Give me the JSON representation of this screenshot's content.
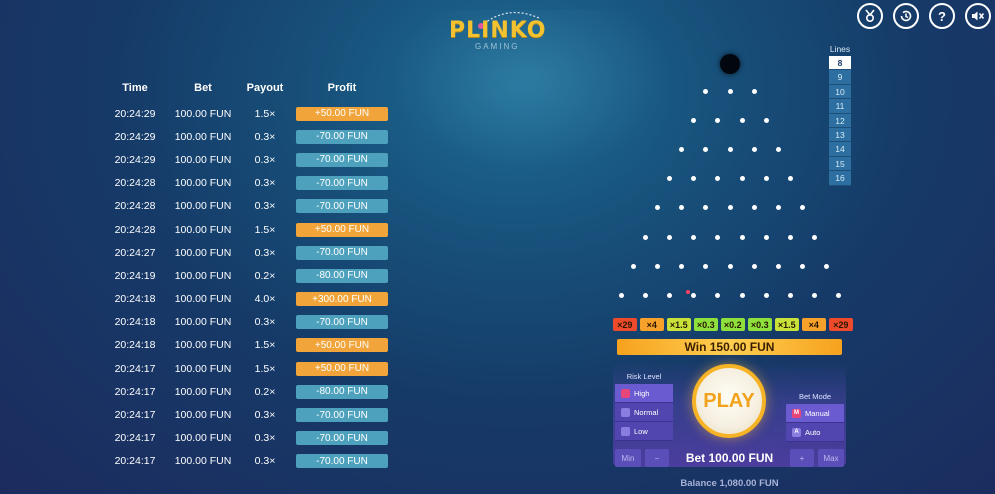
{
  "logo": {
    "title": "PLINKO",
    "subtitle": "GAMING"
  },
  "top_icons": [
    "medal-icon",
    "history-icon",
    "help-icon",
    "mute-icon"
  ],
  "history": {
    "headers": {
      "time": "Time",
      "bet": "Bet",
      "payout": "Payout",
      "profit": "Profit"
    },
    "rows": [
      {
        "time": "20:24:29",
        "bet": "100.00 FUN",
        "payout": "1.5×",
        "profit": "+50.00 FUN",
        "win": true
      },
      {
        "time": "20:24:29",
        "bet": "100.00 FUN",
        "payout": "0.3×",
        "profit": "-70.00 FUN",
        "win": false
      },
      {
        "time": "20:24:29",
        "bet": "100.00 FUN",
        "payout": "0.3×",
        "profit": "-70.00 FUN",
        "win": false
      },
      {
        "time": "20:24:28",
        "bet": "100.00 FUN",
        "payout": "0.3×",
        "profit": "-70.00 FUN",
        "win": false
      },
      {
        "time": "20:24:28",
        "bet": "100.00 FUN",
        "payout": "0.3×",
        "profit": "-70.00 FUN",
        "win": false
      },
      {
        "time": "20:24:28",
        "bet": "100.00 FUN",
        "payout": "1.5×",
        "profit": "+50.00 FUN",
        "win": true
      },
      {
        "time": "20:24:27",
        "bet": "100.00 FUN",
        "payout": "0.3×",
        "profit": "-70.00 FUN",
        "win": false
      },
      {
        "time": "20:24:19",
        "bet": "100.00 FUN",
        "payout": "0.2×",
        "profit": "-80.00 FUN",
        "win": false
      },
      {
        "time": "20:24:18",
        "bet": "100.00 FUN",
        "payout": "4.0×",
        "profit": "+300.00 FUN",
        "win": true
      },
      {
        "time": "20:24:18",
        "bet": "100.00 FUN",
        "payout": "0.3×",
        "profit": "-70.00 FUN",
        "win": false
      },
      {
        "time": "20:24:18",
        "bet": "100.00 FUN",
        "payout": "1.5×",
        "profit": "+50.00 FUN",
        "win": true
      },
      {
        "time": "20:24:17",
        "bet": "100.00 FUN",
        "payout": "1.5×",
        "profit": "+50.00 FUN",
        "win": true
      },
      {
        "time": "20:24:17",
        "bet": "100.00 FUN",
        "payout": "0.2×",
        "profit": "-80.00 FUN",
        "win": false
      },
      {
        "time": "20:24:17",
        "bet": "100.00 FUN",
        "payout": "0.3×",
        "profit": "-70.00 FUN",
        "win": false
      },
      {
        "time": "20:24:17",
        "bet": "100.00 FUN",
        "payout": "0.3×",
        "profit": "-70.00 FUN",
        "win": false
      },
      {
        "time": "20:24:17",
        "bet": "100.00 FUN",
        "payout": "0.3×",
        "profit": "-70.00 FUN",
        "win": false
      }
    ]
  },
  "lines": {
    "title": "Lines",
    "options": [
      "8",
      "9",
      "10",
      "11",
      "12",
      "13",
      "14",
      "15",
      "16"
    ],
    "selected": "8"
  },
  "multipliers": [
    {
      "label": "×29",
      "color": "#ef4a2c"
    },
    {
      "label": "×4",
      "color": "#f6a12a"
    },
    {
      "label": "×1.5",
      "color": "#c8e23a"
    },
    {
      "label": "×0.3",
      "color": "#8ee03c"
    },
    {
      "label": "×0.2",
      "color": "#8ee03c"
    },
    {
      "label": "×0.3",
      "color": "#8ee03c"
    },
    {
      "label": "×1.5",
      "color": "#c8e23a"
    },
    {
      "label": "×4",
      "color": "#f6a12a"
    },
    {
      "label": "×29",
      "color": "#ef4a2c"
    }
  ],
  "win_banner": "Win 150.00 FUN",
  "risk_level": {
    "title": "Risk Level",
    "options": [
      {
        "label": "High",
        "icon": "flame-icon",
        "color": "#e8457a"
      },
      {
        "label": "Normal",
        "icon": "gauge-icon",
        "color": "#8a7de0"
      },
      {
        "label": "Low",
        "icon": "leaf-icon",
        "color": "#8a7de0"
      }
    ],
    "selected": "High"
  },
  "play_label": "PLAY",
  "bet_mode": {
    "title": "Bet Mode",
    "options": [
      {
        "label": "Manual",
        "letter": "M",
        "color": "#e8457a"
      },
      {
        "label": "Auto",
        "letter": "A",
        "color": "#8a7de0"
      }
    ],
    "selected": "Manual"
  },
  "bet": {
    "min_label": "Min",
    "minus_label": "−",
    "amount": "Bet 100.00 FUN",
    "plus_label": "+",
    "max_label": "Max"
  },
  "balance": "Balance 1,080.00 FUN"
}
